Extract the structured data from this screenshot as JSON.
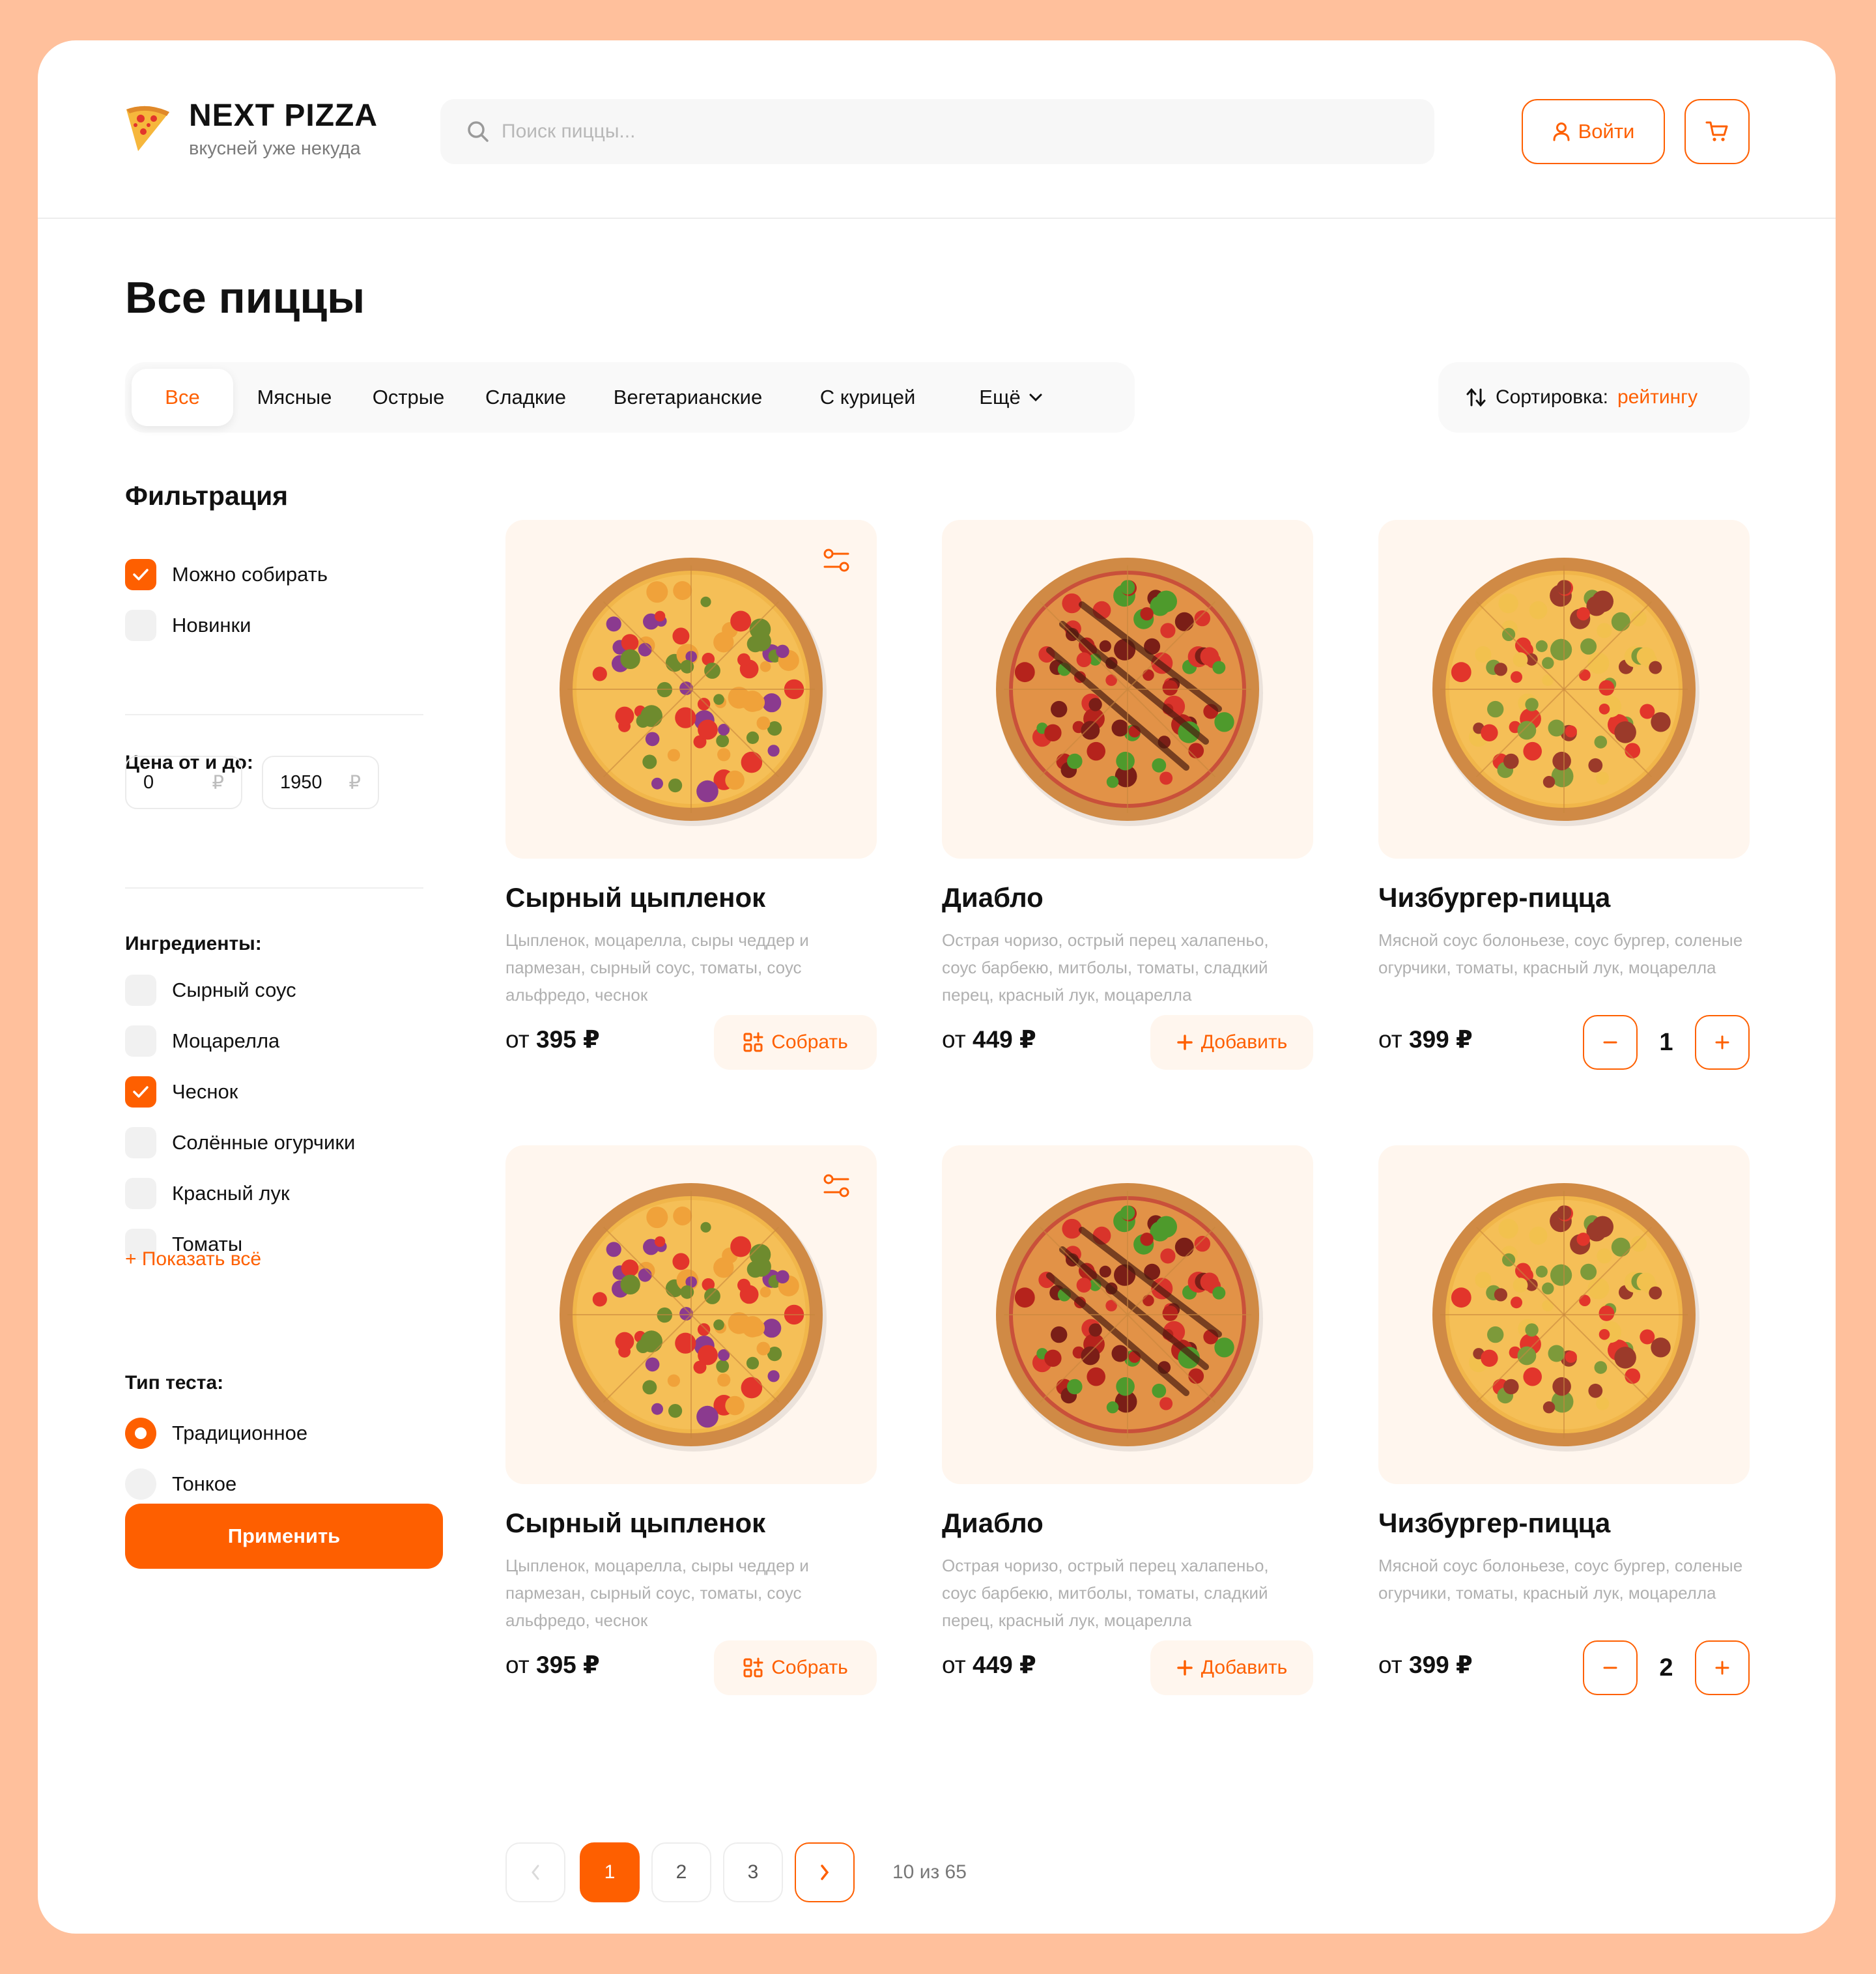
{
  "header": {
    "logo_title": "NEXT PIZZA",
    "logo_subtitle": "вкусней уже некуда",
    "search_placeholder": "Поиск пиццы...",
    "login_label": "Войти"
  },
  "page_title": "Все пиццы",
  "categories": [
    "Все",
    "Мясные",
    "Острые",
    "Сладкие",
    "Вегетарианские",
    "С курицей",
    "Ещё"
  ],
  "active_category": "Все",
  "sort": {
    "label": "Сортировка:",
    "value": "рейтингу"
  },
  "filters": {
    "title": "Фильтрация",
    "options": [
      {
        "label": "Можно собирать",
        "checked": true
      },
      {
        "label": "Новинки",
        "checked": false
      }
    ],
    "price_title": "Цена от и до:",
    "price_from": "0",
    "price_to": "1950",
    "currency": "₽",
    "ingredients_title": "Ингредиенты:",
    "ingredients": [
      {
        "label": "Сырный соус",
        "checked": false
      },
      {
        "label": "Моцарелла",
        "checked": false
      },
      {
        "label": "Чеснок",
        "checked": true
      },
      {
        "label": "Солённые огурчики",
        "checked": false
      },
      {
        "label": "Красный лук",
        "checked": false
      },
      {
        "label": "Томаты",
        "checked": false
      }
    ],
    "show_all": "+ Показать всё",
    "dough_title": "Тип теста:",
    "dough": [
      {
        "label": "Традиционное",
        "selected": true
      },
      {
        "label": "Тонкое",
        "selected": false
      }
    ],
    "apply_label": "Применить"
  },
  "products": [
    {
      "name": "Сырный цыпленок",
      "desc": "Цыпленок, моцарелла, сыры чеддер и пармезан, сырный соус, томаты, соус альфредо, чеснок",
      "price_prefix": "от",
      "price": "395 ₽",
      "action": "Собрать",
      "type": "build"
    },
    {
      "name": "Диабло",
      "desc": "Острая чоризо, острый перец халапеньо, соус барбекю, митболы, томаты, сладкий перец, красный лук, моцарелла",
      "price_prefix": "от",
      "price": "449 ₽",
      "action": "Добавить",
      "type": "add"
    },
    {
      "name": "Чизбургер-пицца",
      "desc": "Мясной соус болоньезе, соус бургер, соленые огурчики, томаты, красный лук, моцарелла",
      "price_prefix": "от",
      "price": "399 ₽",
      "qty": "1",
      "type": "qty"
    },
    {
      "name": "Сырный цыпленок",
      "desc": "Цыпленок, моцарелла, сыры чеддер и пармезан, сырный соус, томаты, соус альфредо, чеснок",
      "price_prefix": "от",
      "price": "395 ₽",
      "action": "Собрать",
      "type": "build"
    },
    {
      "name": "Диабло",
      "desc": "Острая чоризо, острый перец халапеньо, соус барбекю, митболы, томаты, сладкий перец, красный лук, моцарелла",
      "price_prefix": "от",
      "price": "449 ₽",
      "action": "Добавить",
      "type": "add"
    },
    {
      "name": "Чизбургер-пицца",
      "desc": "Мясной соус болоньезе, соус бургер, соленые огурчики, томаты, красный лук, моцарелла",
      "price_prefix": "от",
      "price": "399 ₽",
      "qty": "2",
      "type": "qty"
    }
  ],
  "pagination": {
    "pages": [
      "1",
      "2",
      "3"
    ],
    "current": "1",
    "info": "10 из 65"
  },
  "colors": {
    "accent": "#FE5F00",
    "background": "#FFC09C",
    "card_tint": "#FFF6EE"
  },
  "icons": [
    "pizza-slice-logo-icon",
    "search-icon",
    "user-icon",
    "cart-icon",
    "sort-icon",
    "chevron-down-icon",
    "check-icon",
    "customize-icon",
    "build-icon",
    "plus-icon",
    "minus-icon",
    "chevron-left-icon",
    "chevron-right-icon"
  ]
}
